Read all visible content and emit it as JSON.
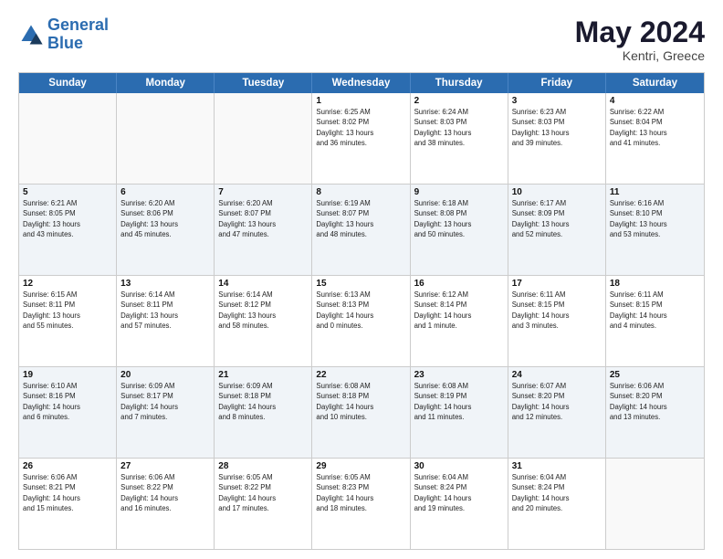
{
  "logo": {
    "line1": "General",
    "line2": "Blue"
  },
  "title": "May 2024",
  "location": "Kentri, Greece",
  "days_of_week": [
    "Sunday",
    "Monday",
    "Tuesday",
    "Wednesday",
    "Thursday",
    "Friday",
    "Saturday"
  ],
  "weeks": [
    [
      {
        "day": "",
        "info": ""
      },
      {
        "day": "",
        "info": ""
      },
      {
        "day": "",
        "info": ""
      },
      {
        "day": "1",
        "info": "Sunrise: 6:25 AM\nSunset: 8:02 PM\nDaylight: 13 hours\nand 36 minutes."
      },
      {
        "day": "2",
        "info": "Sunrise: 6:24 AM\nSunset: 8:03 PM\nDaylight: 13 hours\nand 38 minutes."
      },
      {
        "day": "3",
        "info": "Sunrise: 6:23 AM\nSunset: 8:03 PM\nDaylight: 13 hours\nand 39 minutes."
      },
      {
        "day": "4",
        "info": "Sunrise: 6:22 AM\nSunset: 8:04 PM\nDaylight: 13 hours\nand 41 minutes."
      }
    ],
    [
      {
        "day": "5",
        "info": "Sunrise: 6:21 AM\nSunset: 8:05 PM\nDaylight: 13 hours\nand 43 minutes."
      },
      {
        "day": "6",
        "info": "Sunrise: 6:20 AM\nSunset: 8:06 PM\nDaylight: 13 hours\nand 45 minutes."
      },
      {
        "day": "7",
        "info": "Sunrise: 6:20 AM\nSunset: 8:07 PM\nDaylight: 13 hours\nand 47 minutes."
      },
      {
        "day": "8",
        "info": "Sunrise: 6:19 AM\nSunset: 8:07 PM\nDaylight: 13 hours\nand 48 minutes."
      },
      {
        "day": "9",
        "info": "Sunrise: 6:18 AM\nSunset: 8:08 PM\nDaylight: 13 hours\nand 50 minutes."
      },
      {
        "day": "10",
        "info": "Sunrise: 6:17 AM\nSunset: 8:09 PM\nDaylight: 13 hours\nand 52 minutes."
      },
      {
        "day": "11",
        "info": "Sunrise: 6:16 AM\nSunset: 8:10 PM\nDaylight: 13 hours\nand 53 minutes."
      }
    ],
    [
      {
        "day": "12",
        "info": "Sunrise: 6:15 AM\nSunset: 8:11 PM\nDaylight: 13 hours\nand 55 minutes."
      },
      {
        "day": "13",
        "info": "Sunrise: 6:14 AM\nSunset: 8:11 PM\nDaylight: 13 hours\nand 57 minutes."
      },
      {
        "day": "14",
        "info": "Sunrise: 6:14 AM\nSunset: 8:12 PM\nDaylight: 13 hours\nand 58 minutes."
      },
      {
        "day": "15",
        "info": "Sunrise: 6:13 AM\nSunset: 8:13 PM\nDaylight: 14 hours\nand 0 minutes."
      },
      {
        "day": "16",
        "info": "Sunrise: 6:12 AM\nSunset: 8:14 PM\nDaylight: 14 hours\nand 1 minute."
      },
      {
        "day": "17",
        "info": "Sunrise: 6:11 AM\nSunset: 8:15 PM\nDaylight: 14 hours\nand 3 minutes."
      },
      {
        "day": "18",
        "info": "Sunrise: 6:11 AM\nSunset: 8:15 PM\nDaylight: 14 hours\nand 4 minutes."
      }
    ],
    [
      {
        "day": "19",
        "info": "Sunrise: 6:10 AM\nSunset: 8:16 PM\nDaylight: 14 hours\nand 6 minutes."
      },
      {
        "day": "20",
        "info": "Sunrise: 6:09 AM\nSunset: 8:17 PM\nDaylight: 14 hours\nand 7 minutes."
      },
      {
        "day": "21",
        "info": "Sunrise: 6:09 AM\nSunset: 8:18 PM\nDaylight: 14 hours\nand 8 minutes."
      },
      {
        "day": "22",
        "info": "Sunrise: 6:08 AM\nSunset: 8:18 PM\nDaylight: 14 hours\nand 10 minutes."
      },
      {
        "day": "23",
        "info": "Sunrise: 6:08 AM\nSunset: 8:19 PM\nDaylight: 14 hours\nand 11 minutes."
      },
      {
        "day": "24",
        "info": "Sunrise: 6:07 AM\nSunset: 8:20 PM\nDaylight: 14 hours\nand 12 minutes."
      },
      {
        "day": "25",
        "info": "Sunrise: 6:06 AM\nSunset: 8:20 PM\nDaylight: 14 hours\nand 13 minutes."
      }
    ],
    [
      {
        "day": "26",
        "info": "Sunrise: 6:06 AM\nSunset: 8:21 PM\nDaylight: 14 hours\nand 15 minutes."
      },
      {
        "day": "27",
        "info": "Sunrise: 6:06 AM\nSunset: 8:22 PM\nDaylight: 14 hours\nand 16 minutes."
      },
      {
        "day": "28",
        "info": "Sunrise: 6:05 AM\nSunset: 8:22 PM\nDaylight: 14 hours\nand 17 minutes."
      },
      {
        "day": "29",
        "info": "Sunrise: 6:05 AM\nSunset: 8:23 PM\nDaylight: 14 hours\nand 18 minutes."
      },
      {
        "day": "30",
        "info": "Sunrise: 6:04 AM\nSunset: 8:24 PM\nDaylight: 14 hours\nand 19 minutes."
      },
      {
        "day": "31",
        "info": "Sunrise: 6:04 AM\nSunset: 8:24 PM\nDaylight: 14 hours\nand 20 minutes."
      },
      {
        "day": "",
        "info": ""
      }
    ]
  ]
}
